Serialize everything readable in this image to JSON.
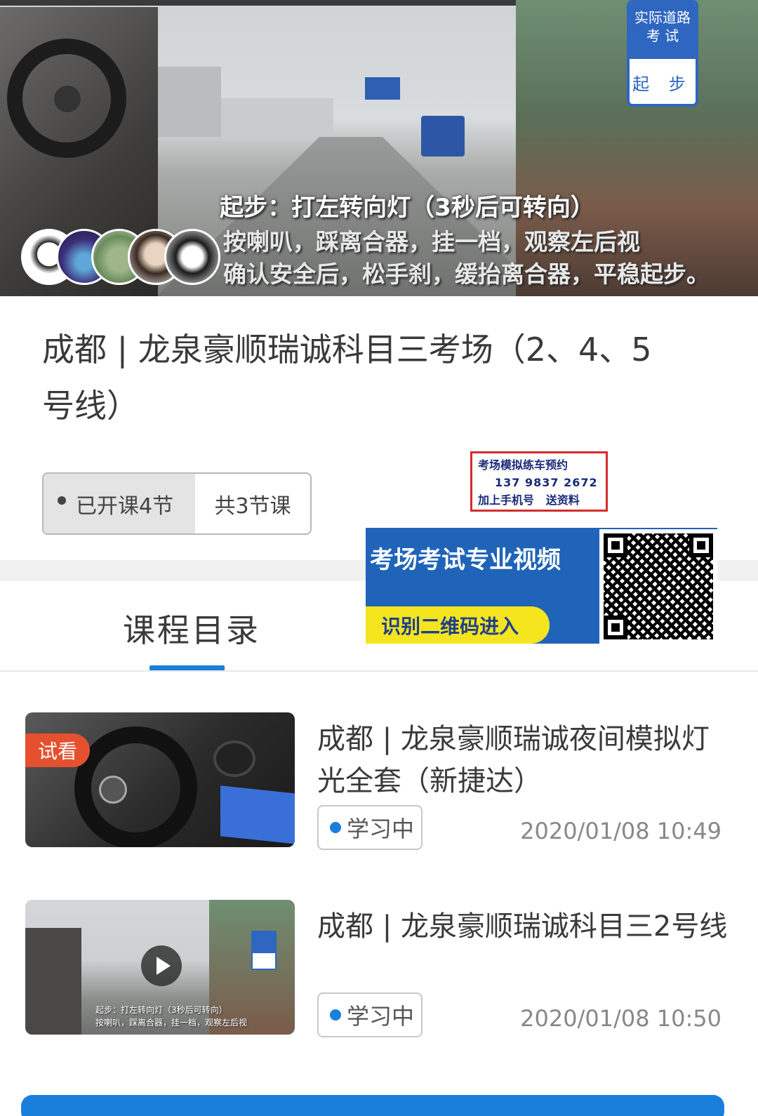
{
  "video": {
    "badge_top": "实际道路\n考 试",
    "badge_bottom": "起 步",
    "subtitle_1": "起步：打左转向灯（3秒后可转向）",
    "subtitle_2": "按喇叭，踩离合器，挂一档，观察左后视",
    "subtitle_3": "确认安全后，松手刹，缓抬离合器，平稳起步。"
  },
  "course": {
    "title": "成都 | 龙泉豪顺瑞诚科目三考场（2、4、5号线）",
    "opened_label": "已开课4节",
    "total_label": "共3节课"
  },
  "promo": {
    "line1": "考场模拟练车预约",
    "line2": "137 9837 2672",
    "line3": "加上手机号   送资料"
  },
  "ad": {
    "title": "考场考试专业视频",
    "button": "识别二维码进入"
  },
  "tabs": {
    "catalog": "课程目录"
  },
  "lessons": [
    {
      "title": "成都 | 龙泉豪顺瑞诚夜间模拟灯光全套（新捷达）",
      "tag": "试看",
      "status": "学习中",
      "time": "2020/01/08 10:49"
    },
    {
      "title": "成都 | 龙泉豪顺瑞诚科目三2号线",
      "status": "学习中",
      "time": "2020/01/08 10:50",
      "thumb_sub_1": "起步：打左转向灯（3秒后可转向）",
      "thumb_sub_2": "按喇叭，踩离合器，挂一档，观察左后视"
    }
  ],
  "colors": {
    "accent": "#1a7fdb",
    "trial_tag": "#e5502f",
    "ad_blue": "#1f64b8",
    "ad_button": "#f4e51f",
    "promo_border": "#d42c2c"
  }
}
